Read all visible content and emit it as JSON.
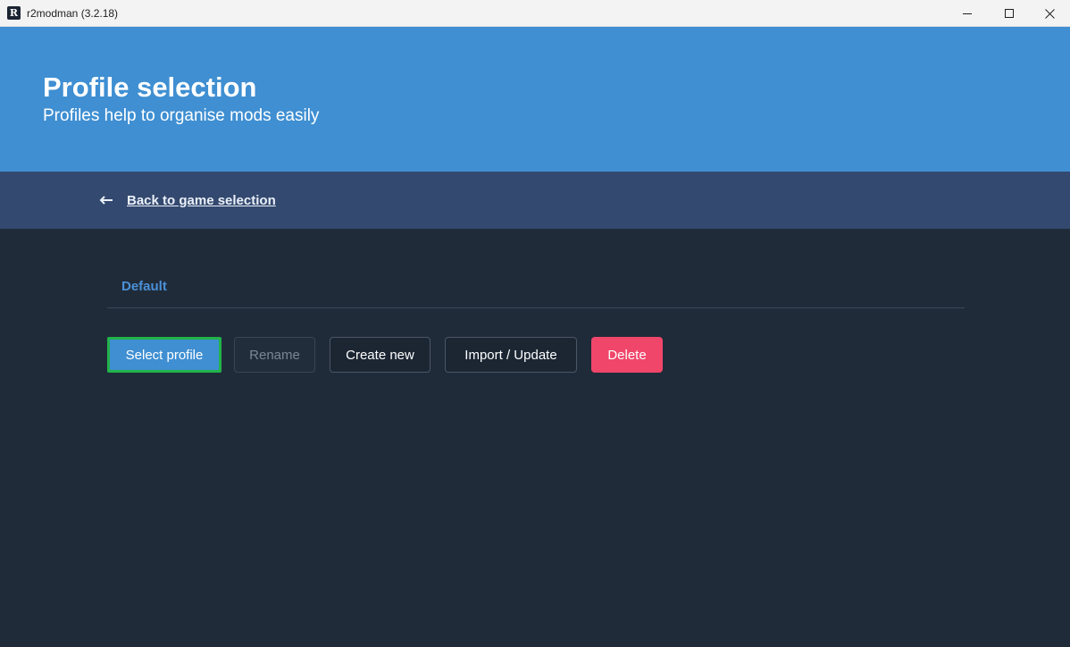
{
  "window": {
    "title": "r2modman (3.2.18)",
    "logo_letter": "R"
  },
  "header": {
    "title": "Profile selection",
    "subtitle": "Profiles help to organise mods easily"
  },
  "navigation": {
    "back_label": "Back to game selection"
  },
  "profiles": [
    {
      "name": "Default",
      "selected": true
    }
  ],
  "actions": {
    "select_label": "Select profile",
    "rename_label": "Rename",
    "create_label": "Create new",
    "import_label": "Import / Update",
    "delete_label": "Delete"
  },
  "colors": {
    "header_bg": "#3f8fd2",
    "backbar_bg": "#34496f",
    "content_bg": "#202b3a",
    "accent": "#4a90d6",
    "danger": "#f0466a",
    "focus_outline": "#22b34a"
  },
  "icons": {
    "back": "arrow-left-icon",
    "minimize": "minimize-icon",
    "maximize": "maximize-icon",
    "close": "close-icon"
  }
}
